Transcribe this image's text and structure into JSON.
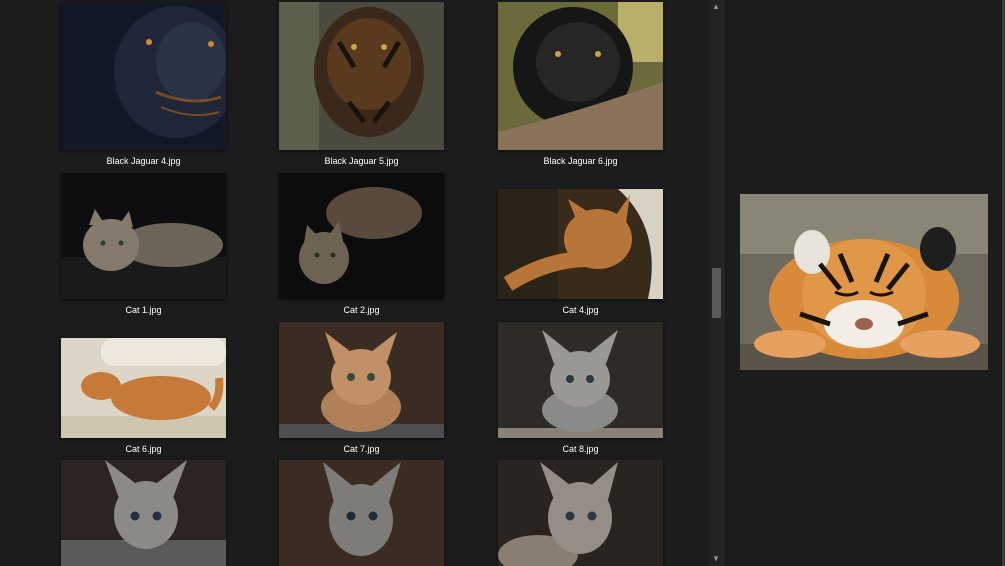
{
  "window": {
    "background": "#1c1c1c",
    "text_color": "#ffffff"
  },
  "files": [
    {
      "name": "Black Jaguar 4.jpg",
      "subject": "black-jaguar-thumbnail"
    },
    {
      "name": "Black Jaguar 5.jpg",
      "subject": "tiger-striped-jaguar-thumbnail"
    },
    {
      "name": "Black Jaguar 6.jpg",
      "subject": "black-jaguar-on-branch-thumbnail"
    },
    {
      "name": "Cat 1.jpg",
      "subject": "tabby-cat-lying-thumbnail"
    },
    {
      "name": "Cat 2.jpg",
      "subject": "tabby-cat-crouching-thumbnail"
    },
    {
      "name": "Cat 4.jpg",
      "subject": "orange-cat-reaching-thumbnail"
    },
    {
      "name": "Cat 6.jpg",
      "subject": "orange-cat-sleeping-thumbnail"
    },
    {
      "name": "Cat 7.jpg",
      "subject": "orange-kitten-thumbnail"
    },
    {
      "name": "Cat 8.jpg",
      "subject": "tabby-kitten-thumbnail"
    },
    {
      "name": "",
      "subject": "gray-kitten-thumbnail"
    },
    {
      "name": "",
      "subject": "gray-kitten-thumbnail"
    },
    {
      "name": "",
      "subject": "gray-kitten-thumbnail"
    }
  ],
  "scrollbar": {
    "up_arrow": "▲",
    "down_arrow": "▼",
    "position_fraction": 0.5
  },
  "preview": {
    "subject": "sleeping-tiger-cub-preview"
  }
}
